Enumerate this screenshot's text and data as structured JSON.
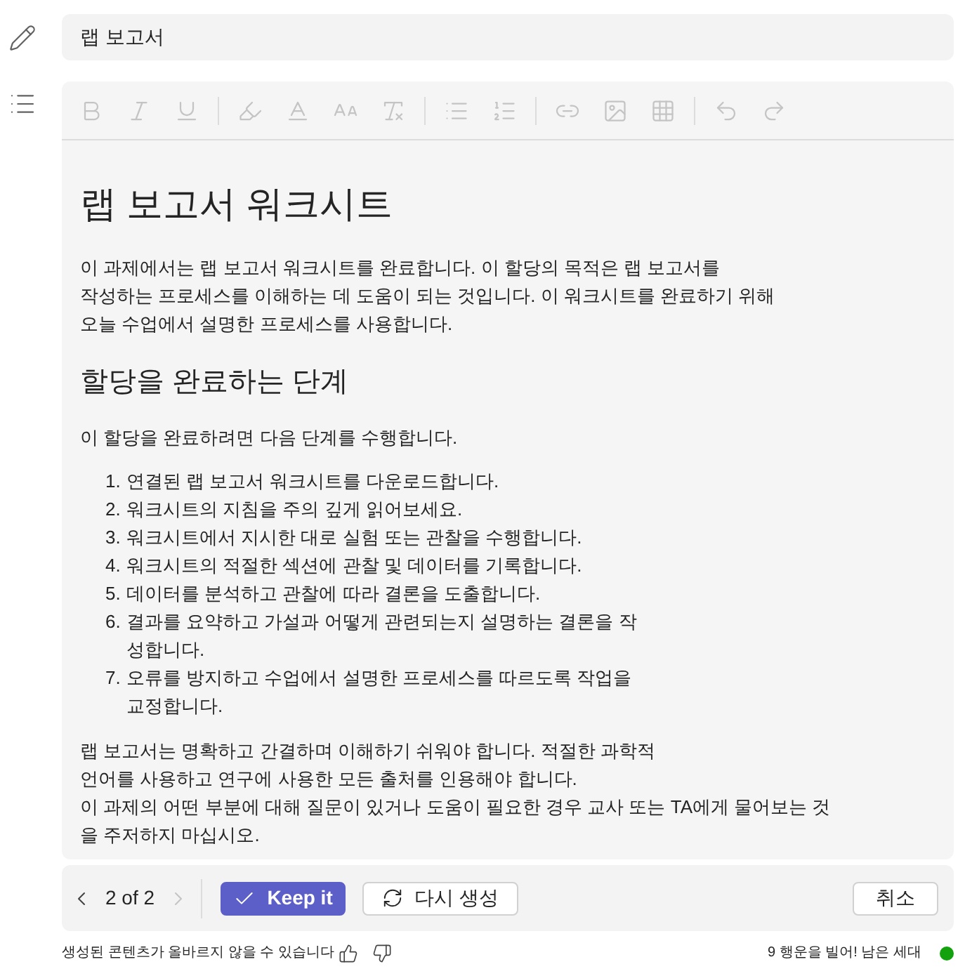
{
  "title_field": {
    "value": "랩 보고서"
  },
  "toolbar": {
    "groups": [
      [
        {
          "kind": "bold",
          "disabled": true
        },
        {
          "kind": "italic",
          "disabled": true
        },
        {
          "kind": "underline",
          "disabled": true
        }
      ],
      [
        {
          "kind": "highlight",
          "disabled": true
        },
        {
          "kind": "font_color",
          "disabled": true
        },
        {
          "kind": "font_size",
          "disabled": true
        },
        {
          "kind": "clear_format",
          "disabled": true
        }
      ],
      [
        {
          "kind": "bullets",
          "disabled": true
        },
        {
          "kind": "numbering",
          "disabled": true
        }
      ],
      [
        {
          "kind": "link",
          "disabled": true
        },
        {
          "kind": "image",
          "disabled": true
        },
        {
          "kind": "table",
          "disabled": true
        }
      ],
      [
        {
          "kind": "undo",
          "disabled": true
        },
        {
          "kind": "redo",
          "disabled": true
        }
      ]
    ]
  },
  "document": {
    "blocks": [
      {
        "kind": "heading1",
        "text": "랩 보고서 워크시트"
      },
      {
        "kind": "paragraph",
        "lines": [
          "이 과제에서는 랩 보고서 워크시트를 완료합니다. 이 할당의 목적은 랩 보고서를",
          "작성하는 프로세스를 이해하는 데 도움이 되는 것입니다. 이 워크시트를 완료하기 위해",
          "오늘 수업에서 설명한 프로세스를 사용합니다."
        ]
      },
      {
        "kind": "heading2",
        "text": "할당을 완료하는 단계"
      },
      {
        "kind": "paragraph",
        "lines": [
          "이 할당을 완료하려면 다음 단계를 수행합니다."
        ]
      },
      {
        "kind": "ordered_list",
        "items": [
          {
            "number": "1.",
            "text": "연결된 랩 보고서 워크시트를 다운로드합니다."
          },
          {
            "number": "2.",
            "text": "워크시트의 지침을 주의 깊게 읽어보세요."
          },
          {
            "number": "3.",
            "text": "워크시트에서 지시한 대로 실험 또는 관찰을 수행합니다."
          },
          {
            "number": "4.",
            "text": "워크시트의 적절한 섹션에 관찰 및 데이터를 기록합니다."
          },
          {
            "number": "5.",
            "text": "데이터를 분석하고 관찰에 따라 결론을 도출합니다."
          },
          {
            "number": "6.",
            "text": "결과를 요약하고 가설과 어떻게 관련되는지 설명하는 결론을 작성합니다."
          },
          {
            "number": "7.",
            "text": "오류를 방지하고 수업에서 설명한 프로세스를 따르도록 작업을 교정합니다."
          }
        ]
      },
      {
        "kind": "paragraph",
        "lines": [
          "랩 보고서는 명확하고 간결하며 이해하기 쉬워야 합니다. 적절한 과학적",
          "언어를 사용하고 연구에 사용한 모든 출처를 인용해야 합니다.",
          "이 과제의 어떤 부분에 대해 질문이 있거나 도움이 필요한 경우 교사 또는 TA에게 물어보는 것",
          "을 주저하지 마십시오."
        ]
      }
    ]
  },
  "action_bar": {
    "pager": {
      "label": "2 of 2",
      "previous_disabled": false,
      "next_disabled": true
    },
    "buttons": [
      {
        "kind": "primary",
        "label": "Keep it"
      },
      {
        "kind": "secondary",
        "label": "다시 생성"
      },
      {
        "kind": "cancel",
        "label": "취소"
      }
    ]
  },
  "footer": {
    "disclaimer": "생성된 콘텐츠가 올바르지 않을 수 있습니다",
    "remaining": "9 행운을 빌어! 남은 세대"
  }
}
